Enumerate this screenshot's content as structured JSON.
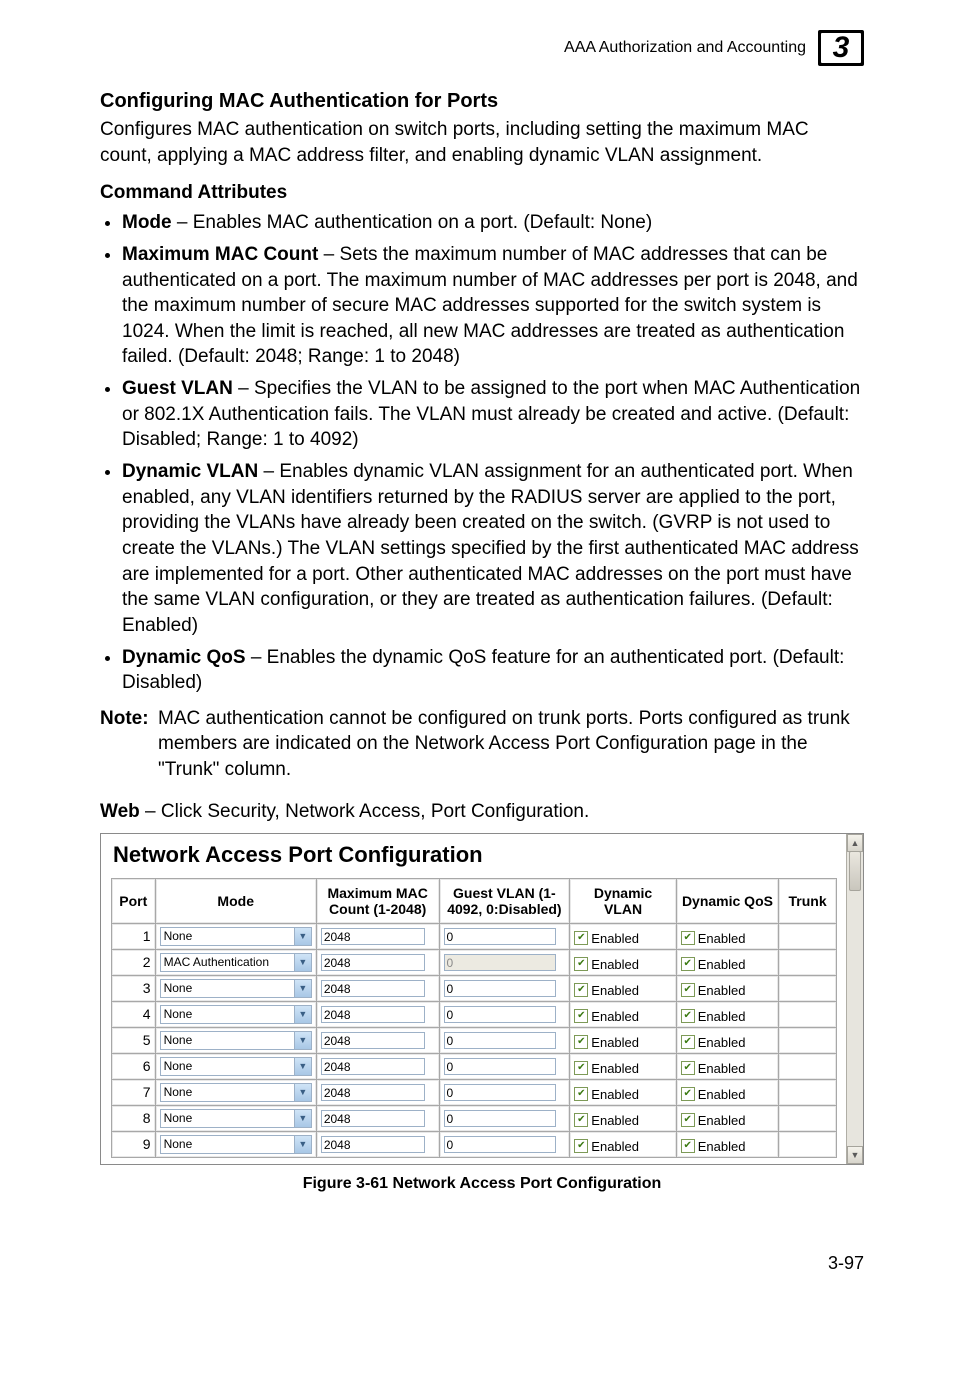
{
  "header": {
    "section": "AAA Authorization and Accounting",
    "chapter": "3"
  },
  "section_title": "Configuring MAC Authentication for Ports",
  "intro": "Configures MAC authentication on switch ports, including setting the maximum MAC count, applying a MAC address filter, and enabling dynamic VLAN assignment.",
  "command_attributes_label": "Command Attributes",
  "attrs": [
    {
      "b": "Mode",
      "t": " – Enables MAC authentication on a port. (Default: None)"
    },
    {
      "b": "Maximum MAC Count",
      "t": " – Sets the maximum number of MAC addresses that can be authenticated on a port. The maximum number of MAC addresses per port is 2048, and the maximum number of secure MAC addresses supported for the switch system is 1024. When the limit is reached, all new MAC addresses are treated as authentication failed. (Default: 2048; Range: 1 to 2048)"
    },
    {
      "b": "Guest VLAN",
      "t": " – Specifies the VLAN to be assigned to the port when MAC Authentication or 802.1X Authentication fails. The VLAN must already be created and active. (Default: Disabled; Range: 1 to 4092)"
    },
    {
      "b": "Dynamic VLAN",
      "t": " – Enables dynamic VLAN assignment for an authenticated port. When enabled, any VLAN identifiers returned by the RADIUS server are applied to the port, providing the VLANs have already been created on the switch. (GVRP is not used to create the VLANs.) The VLAN settings specified by the first authenticated MAC address are implemented for a port. Other authenticated MAC addresses on the port must have the same VLAN configuration, or they are treated as authentication failures. (Default: Enabled)"
    },
    {
      "b": "Dynamic QoS",
      "t": " – Enables the dynamic QoS feature for an authenticated port. (Default: Disabled)"
    }
  ],
  "note": {
    "label": "Note:",
    "text": "MAC authentication cannot be configured on trunk ports. Ports configured as trunk members are indicated on the Network Access Port Configuration page in the \"Trunk\" column."
  },
  "web": {
    "b": "Web",
    "t": " – Click Security, Network Access, Port Configuration."
  },
  "panel": {
    "title": "Network Access Port Configuration",
    "columns": {
      "port": "Port",
      "mode": "Mode",
      "mac": "Maximum MAC Count (1-2048)",
      "guest": "Guest VLAN (1-4092, 0:Disabled)",
      "dvlan": "Dynamic VLAN",
      "dqos": "Dynamic QoS",
      "trunk": "Trunk"
    },
    "rows": [
      {
        "port": "1",
        "mode": "None",
        "mac": "2048",
        "guest": "0",
        "guest_disabled": false,
        "dvlan": "Enabled",
        "dqos": "Enabled",
        "trunk": ""
      },
      {
        "port": "2",
        "mode": "MAC Authentication",
        "mac": "2048",
        "guest": "0",
        "guest_disabled": true,
        "dvlan": "Enabled",
        "dqos": "Enabled",
        "trunk": ""
      },
      {
        "port": "3",
        "mode": "None",
        "mac": "2048",
        "guest": "0",
        "guest_disabled": false,
        "dvlan": "Enabled",
        "dqos": "Enabled",
        "trunk": ""
      },
      {
        "port": "4",
        "mode": "None",
        "mac": "2048",
        "guest": "0",
        "guest_disabled": false,
        "dvlan": "Enabled",
        "dqos": "Enabled",
        "trunk": ""
      },
      {
        "port": "5",
        "mode": "None",
        "mac": "2048",
        "guest": "0",
        "guest_disabled": false,
        "dvlan": "Enabled",
        "dqos": "Enabled",
        "trunk": ""
      },
      {
        "port": "6",
        "mode": "None",
        "mac": "2048",
        "guest": "0",
        "guest_disabled": false,
        "dvlan": "Enabled",
        "dqos": "Enabled",
        "trunk": ""
      },
      {
        "port": "7",
        "mode": "None",
        "mac": "2048",
        "guest": "0",
        "guest_disabled": false,
        "dvlan": "Enabled",
        "dqos": "Enabled",
        "trunk": ""
      },
      {
        "port": "8",
        "mode": "None",
        "mac": "2048",
        "guest": "0",
        "guest_disabled": false,
        "dvlan": "Enabled",
        "dqos": "Enabled",
        "trunk": ""
      },
      {
        "port": "9",
        "mode": "None",
        "mac": "2048",
        "guest": "0",
        "guest_disabled": false,
        "dvlan": "Enabled",
        "dqos": "Enabled",
        "trunk": ""
      }
    ]
  },
  "caption": "Figure 3-61  Network Access Port Configuration",
  "page_number": "3-97"
}
